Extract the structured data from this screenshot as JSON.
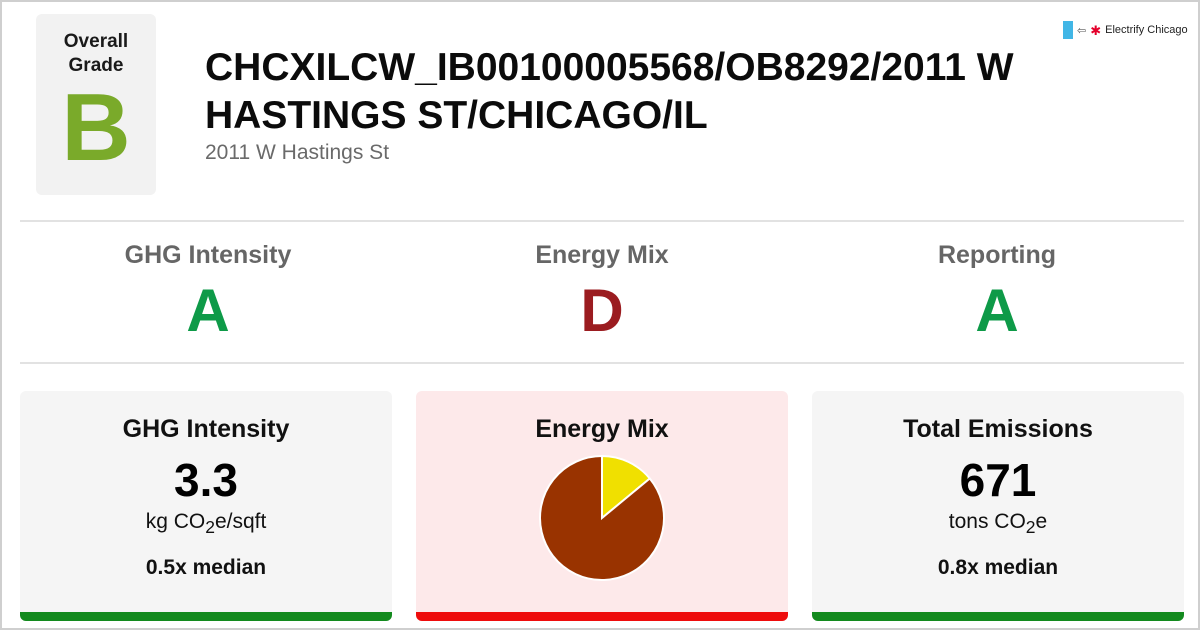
{
  "header": {
    "overall_grade_label": "Overall Grade",
    "overall_grade": "B",
    "title": "CHCXILCW_IB00100005568/OB8292/2011 W HASTINGS ST/CHICAGO/IL",
    "address": "2011 W Hastings St",
    "brand": "Electrify Chicago"
  },
  "sub_grades": [
    {
      "label": "GHG Intensity",
      "grade": "A",
      "color": "#0e9a48"
    },
    {
      "label": "Energy Mix",
      "grade": "D",
      "color": "#9b1c20"
    },
    {
      "label": "Reporting",
      "grade": "A",
      "color": "#0e9a48"
    }
  ],
  "cards": {
    "ghg": {
      "title": "GHG Intensity",
      "value": "3.3",
      "unit_prefix": "kg CO",
      "unit_sub": "2",
      "unit_suffix": "e/sqft",
      "median": "0.5x median",
      "bar_color": "#138a1e"
    },
    "mix": {
      "title": "Energy Mix",
      "bar_color": "#ee0c0c"
    },
    "emissions": {
      "title": "Total Emissions",
      "value": "671",
      "unit_prefix": "tons CO",
      "unit_sub": "2",
      "unit_suffix": "e",
      "median": "0.8x median",
      "bar_color": "#138a1e"
    }
  },
  "colors": {
    "overall_grade": "#7aaa2a",
    "electric_slice": "#f0e000",
    "fossil_slice": "#993300"
  },
  "chart_data": {
    "type": "pie",
    "title": "",
    "slices": [
      {
        "value": 14,
        "color": "#f0e000"
      },
      {
        "value": 86,
        "color": "#993300"
      }
    ]
  }
}
